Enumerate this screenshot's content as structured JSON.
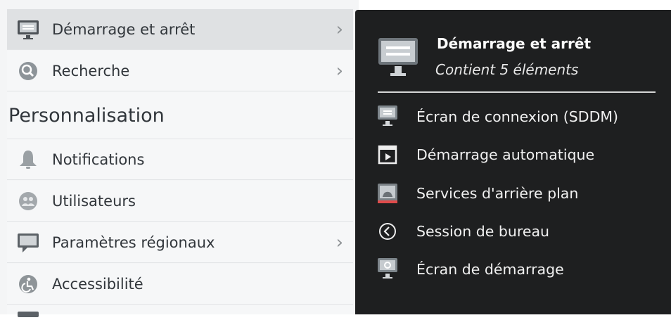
{
  "settings_list": {
    "items": [
      {
        "label": "Démarrage et arrêt",
        "has_submenu": true,
        "selected": true,
        "icon": "monitor-startup-icon"
      },
      {
        "label": "Recherche",
        "has_submenu": true,
        "selected": false,
        "icon": "search-icon"
      }
    ],
    "section_title": "Personnalisation",
    "personalization_items": [
      {
        "label": "Notifications",
        "has_submenu": false,
        "icon": "bell-icon"
      },
      {
        "label": "Utilisateurs",
        "has_submenu": false,
        "icon": "users-icon"
      },
      {
        "label": "Paramètres régionaux",
        "has_submenu": true,
        "icon": "speech-bubble-icon"
      },
      {
        "label": "Accessibilité",
        "has_submenu": false,
        "icon": "accessibility-icon"
      }
    ],
    "chevron": "›"
  },
  "tooltip": {
    "title": "Démarrage et arrêt",
    "subtitle": "Contient 5 éléments",
    "icon": "monitor-startup-icon",
    "entries": [
      {
        "label": "Écran de connexion (SDDM)",
        "icon": "login-screen-icon"
      },
      {
        "label": "Démarrage automatique",
        "icon": "autostart-icon"
      },
      {
        "label": "Services d'arrière plan",
        "icon": "background-services-icon"
      },
      {
        "label": "Session de bureau",
        "icon": "desktop-session-icon"
      },
      {
        "label": "Écran de démarrage",
        "icon": "splash-screen-icon"
      }
    ]
  },
  "colors": {
    "list_background": "#f6f7f8",
    "selected_row": "#dfe1e3",
    "tooltip_background": "#1e1f20",
    "text_dark": "#31363b",
    "text_light": "#f0f0f0"
  }
}
